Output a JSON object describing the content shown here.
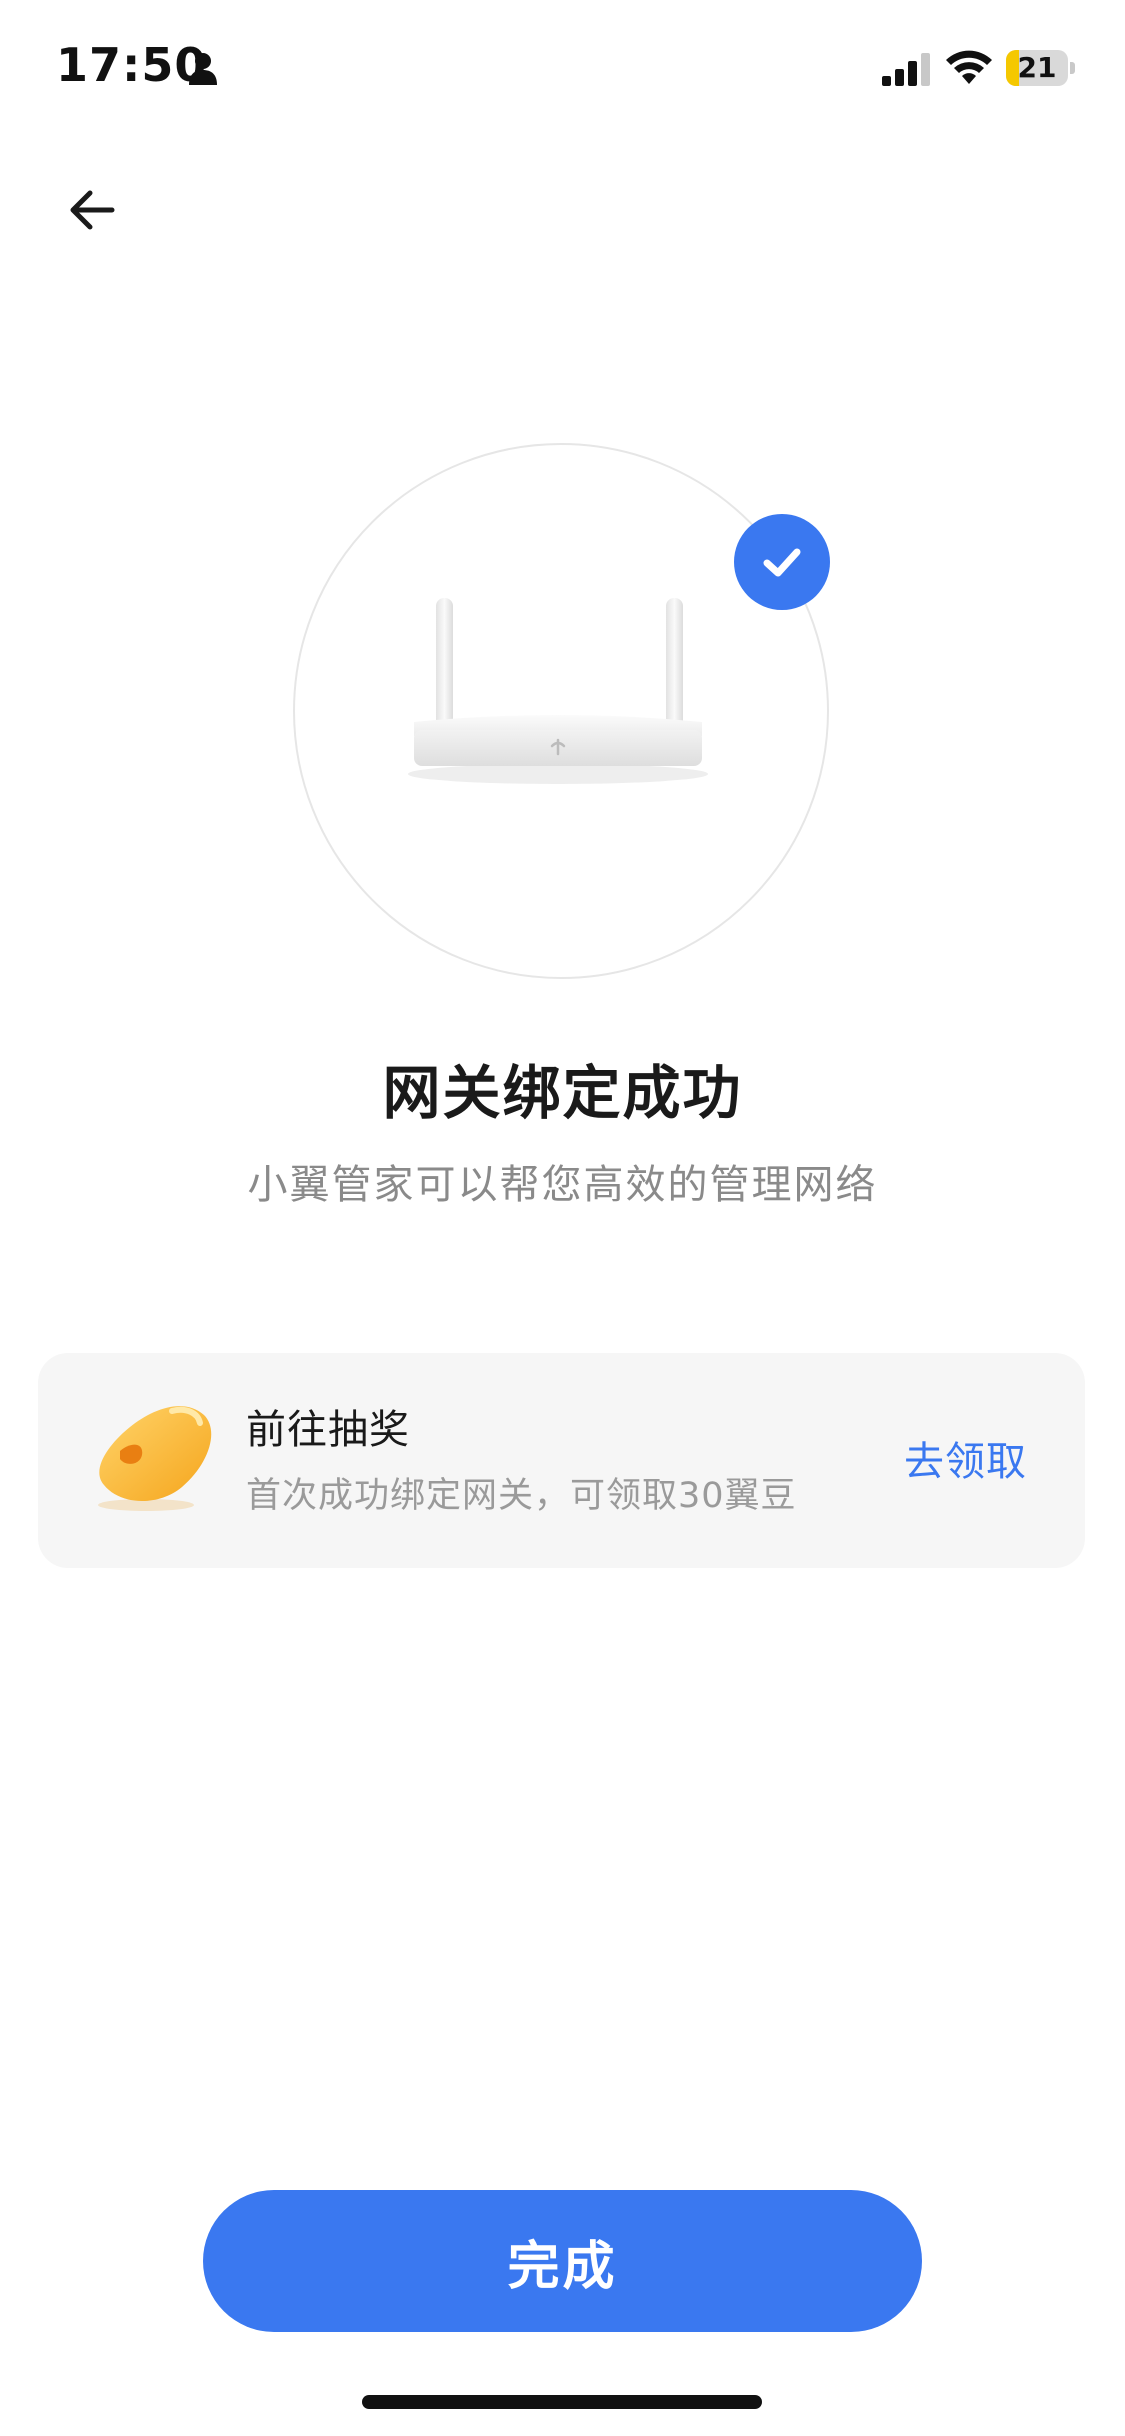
{
  "status_bar": {
    "time": "17:50",
    "battery_level": "21",
    "battery_fraction": 0.21,
    "battery_color": "#f5c800",
    "icons": [
      "person-icon",
      "signal-icon",
      "wifi-icon",
      "battery-icon"
    ]
  },
  "nav": {
    "back_icon": "arrow-left-icon"
  },
  "result": {
    "title": "网关绑定成功",
    "subtitle": "小翼管家可以帮您高效的管理网络",
    "badge_icon": "check-circle-icon"
  },
  "reward_card": {
    "title": "前往抽奖",
    "description": "首次成功绑定网关，可领取30翼豆",
    "action_label": "去领取",
    "icon": "bean-icon"
  },
  "footer": {
    "done_label": "完成"
  },
  "colors": {
    "accent": "#3a78f0",
    "card_background": "#f6f6f6",
    "subtitle_text": "#8a8a8a"
  }
}
